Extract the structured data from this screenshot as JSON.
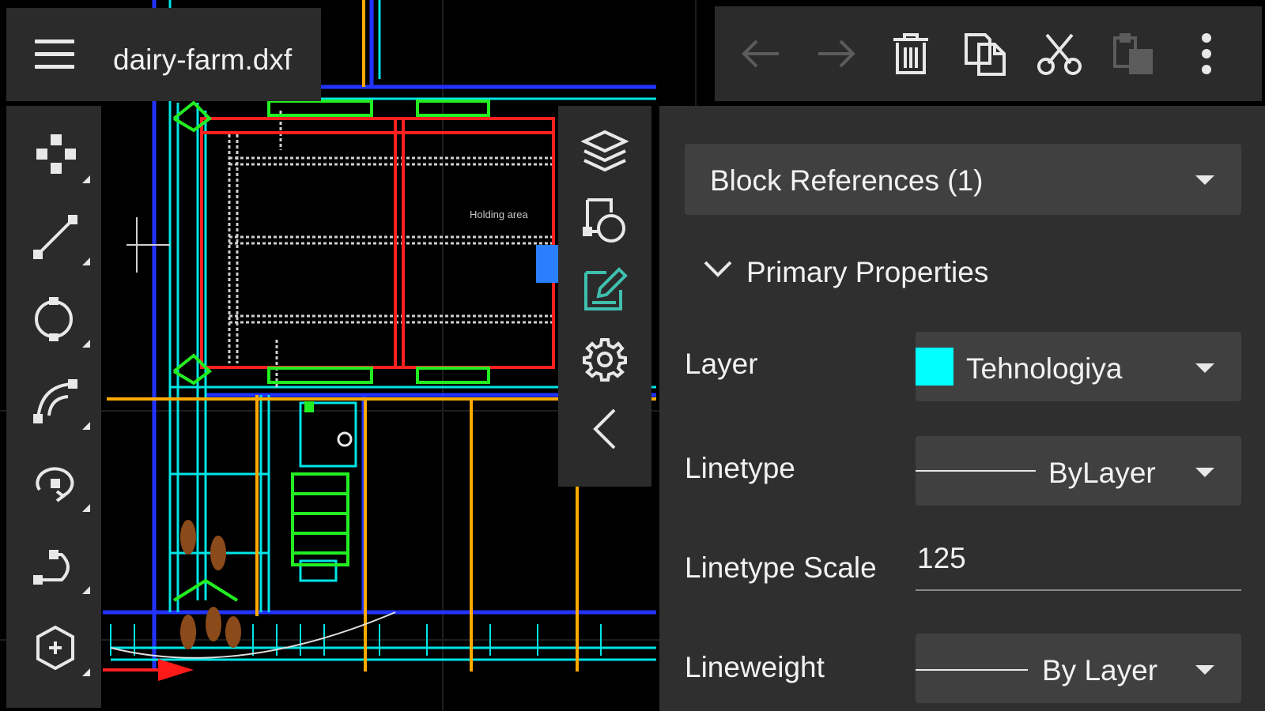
{
  "app": {
    "file_name": "dairy-farm.dxf"
  },
  "drawing": {
    "annotation_holding_area": "Holding area"
  },
  "toolbar": {
    "undo": "undo-icon",
    "redo": "redo-icon",
    "delete": "trash-icon",
    "copy": "copy-icon",
    "cut": "cut-icon",
    "paste": "paste-icon",
    "more": "more-vert-icon"
  },
  "draw_tools": [
    "move-icon",
    "line-icon",
    "circle-icon",
    "arc-icon",
    "rotate-icon",
    "polyline-icon",
    "polygon-icon"
  ],
  "side_tools": [
    "layers-icon",
    "block-insert-icon",
    "edit-text-icon",
    "settings-icon",
    "collapse-icon"
  ],
  "properties": {
    "entity_type": "Block References (1)",
    "section_title": "Primary Properties",
    "layer_label": "Layer",
    "layer_value": "Tehnologiya",
    "layer_color": "#00ffff",
    "linetype_label": "Linetype",
    "linetype_value": "ByLayer",
    "linetype_scale_label": "Linetype Scale",
    "linetype_scale_value": "125",
    "lineweight_label": "Lineweight",
    "lineweight_value": "By Layer"
  },
  "colors": {
    "panel": "#2b2b2b",
    "accent_cyan": "#00ffff",
    "cad_red": "#ff2020",
    "cad_green": "#22ee22",
    "cad_blue": "#2233ff",
    "cad_yellow": "#ffaa00"
  }
}
